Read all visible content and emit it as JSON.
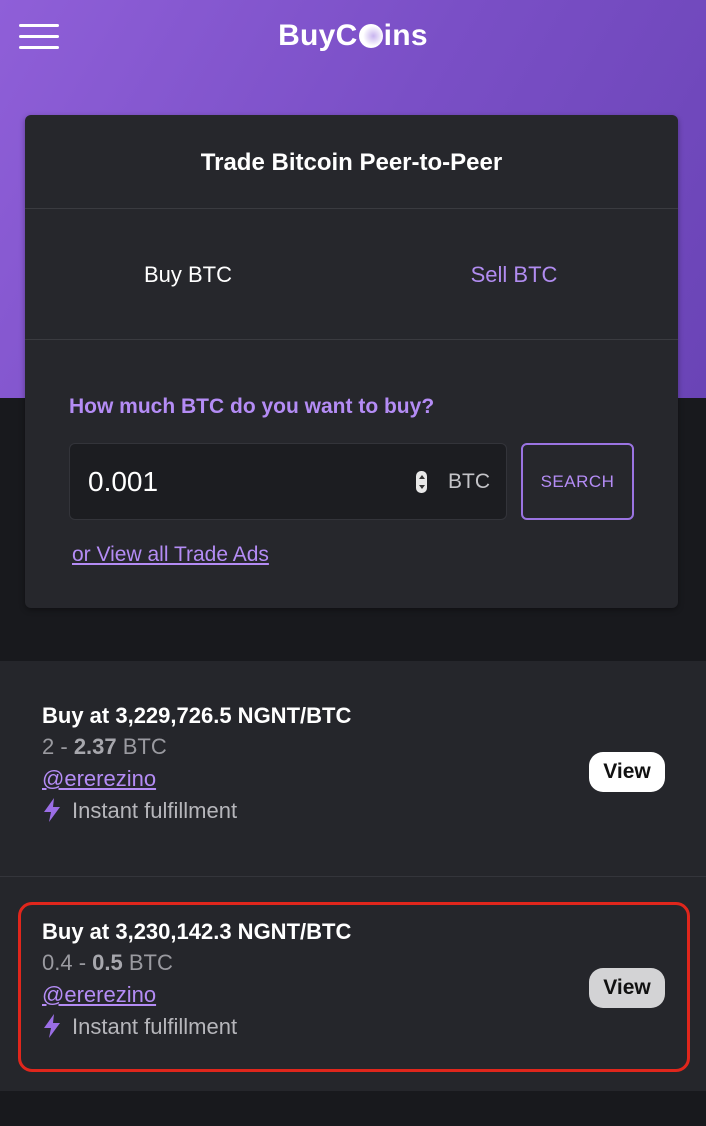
{
  "app": {
    "brand_prefix": "BuyC",
    "brand_suffix": "ins"
  },
  "card": {
    "title": "Trade Bitcoin Peer-to-Peer",
    "tabs": [
      {
        "label": "Buy BTC",
        "active": true
      },
      {
        "label": "Sell BTC",
        "active": false
      }
    ],
    "question": "How much BTC do you want to buy?",
    "amount_value": "0.001",
    "amount_unit": "BTC",
    "search_label": "SEARCH",
    "view_all_label": "or View all Trade Ads"
  },
  "ads": [
    {
      "title": "Buy at 3,229,726.5 NGNT/BTC",
      "range_min": "2",
      "range_sep": " - ",
      "range_max": "2.37",
      "range_unit": " BTC",
      "user": "@ererezino",
      "fulfillment": "Instant fulfillment",
      "view_label": "View"
    },
    {
      "title": "Buy at 3,230,142.3 NGNT/BTC",
      "range_min": "0.4",
      "range_sep": " - ",
      "range_max": "0.5",
      "range_unit": " BTC",
      "user": "@ererezino",
      "fulfillment": "Instant fulfillment",
      "view_label": "View"
    }
  ],
  "colors": {
    "accent": "#b48cf5",
    "hero_gradient_start": "#8f5fd8",
    "hero_gradient_end": "#6a44b6",
    "highlight_border": "#e0261c"
  },
  "icons": {
    "menu": "hamburger-menu-icon",
    "bolt": "lightning-bolt-icon",
    "spinner": "number-spinner-icon"
  }
}
